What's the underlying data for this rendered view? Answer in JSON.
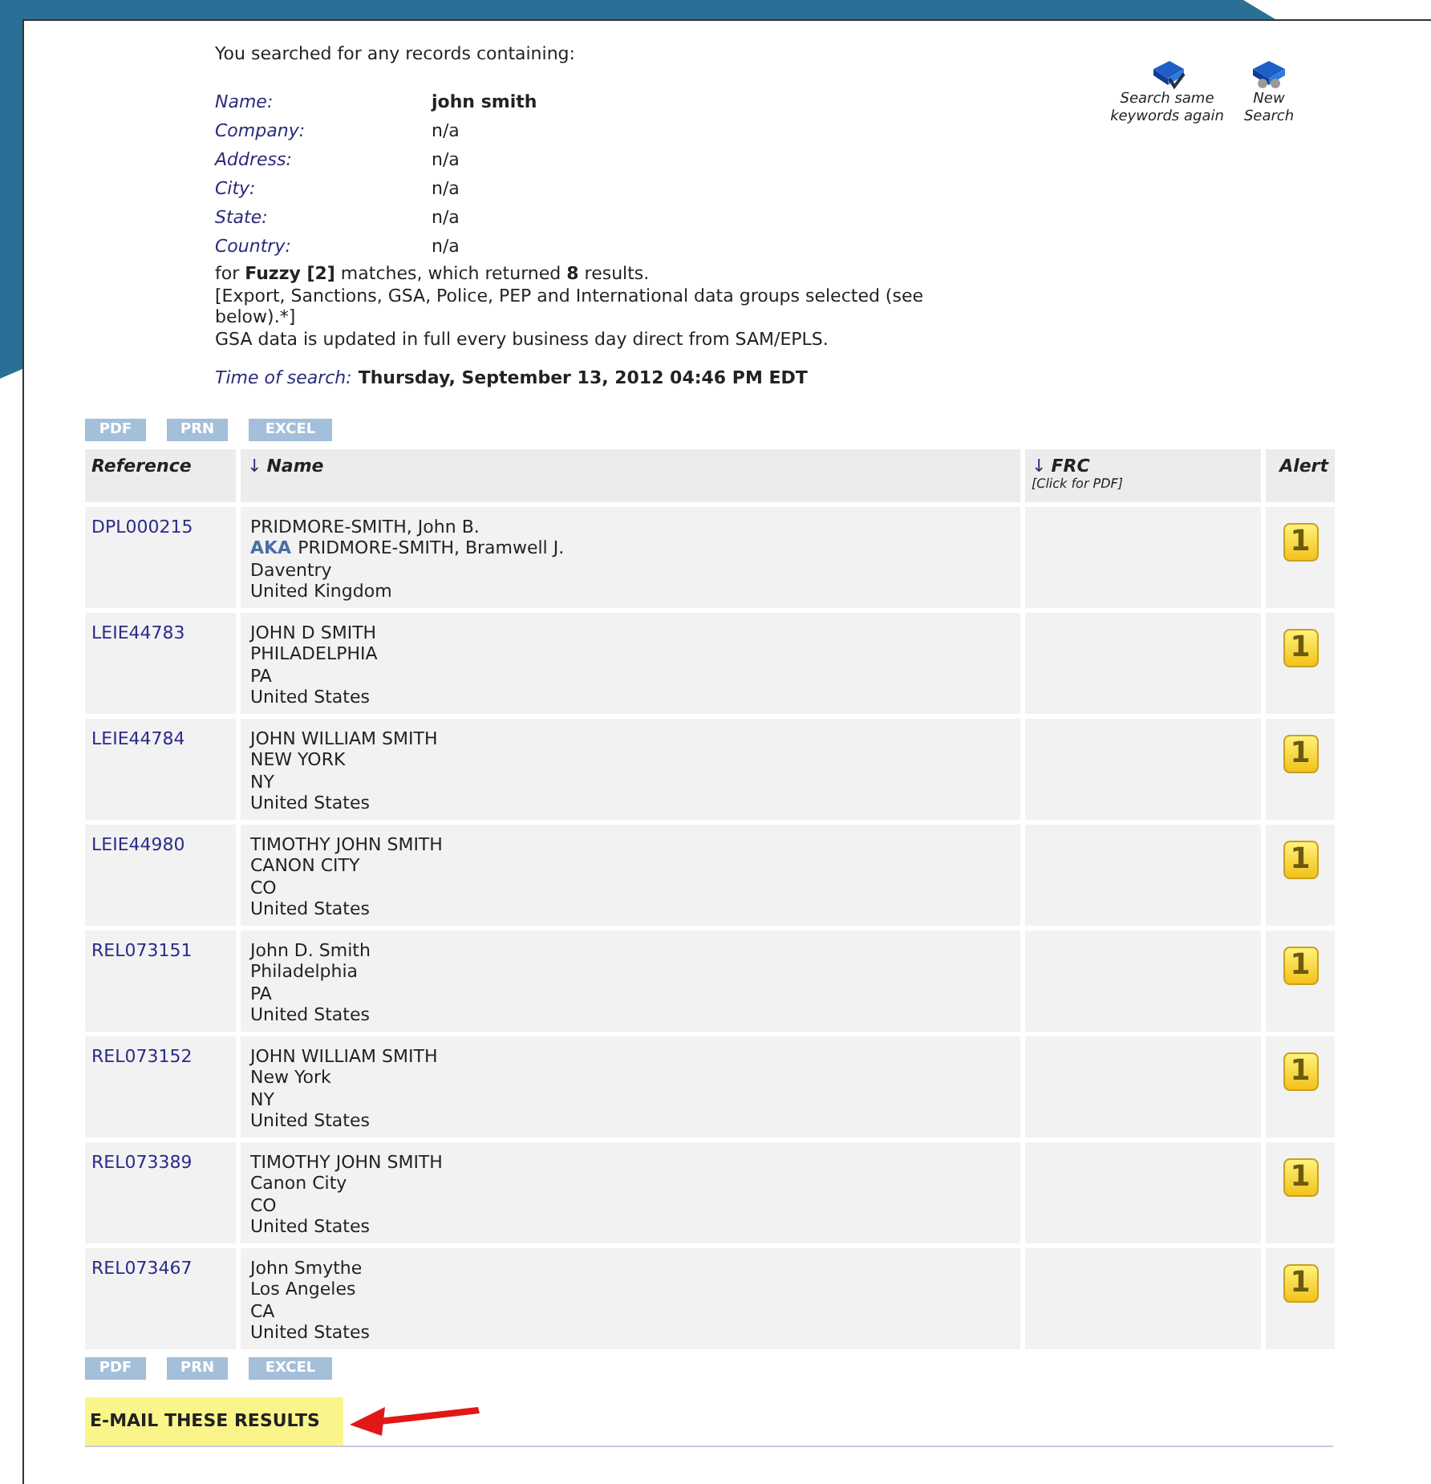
{
  "intro": "You searched for any records containing:",
  "criteria": [
    {
      "label": "Name:",
      "value": "john smith",
      "bold": true
    },
    {
      "label": "Company:",
      "value": "n/a",
      "bold": false
    },
    {
      "label": "Address:",
      "value": "n/a",
      "bold": false
    },
    {
      "label": "City:",
      "value": "n/a",
      "bold": false
    },
    {
      "label": "State:",
      "value": "n/a",
      "bold": false
    },
    {
      "label": "Country:",
      "value": "n/a",
      "bold": false
    }
  ],
  "summary": [
    "for **Fuzzy [2]** matches, which returned **8** results.",
    "[Export, Sanctions, GSA, Police, PEP and International data groups selected (see below).*]",
    "GSA data is updated in full every business day direct from SAM/EPLS."
  ],
  "time_label": "Time of search:",
  "time_value": "Thursday, September 13, 2012 04:46 PM EDT",
  "actions": [
    {
      "kind": "again",
      "label": "Search same keywords again"
    },
    {
      "kind": "new",
      "label": "New Search"
    }
  ],
  "export_buttons_top": [
    "PDF",
    "PRN",
    "EXCEL"
  ],
  "export_buttons_bottom": [
    "PDF",
    "PRN",
    "EXCEL"
  ],
  "columns": [
    {
      "label": "Reference"
    },
    {
      "label": "Name",
      "sort_arrow": "↓"
    },
    {
      "label": "FRC",
      "sort_arrow": "↓",
      "note": "[Click for PDF]"
    },
    {
      "label": "Alert"
    }
  ],
  "rows": [
    {
      "reference": "DPL000215",
      "name": "PRIDMORE-SMITH, John B.",
      "aka_label": "AKA",
      "aka": "PRIDMORE-SMITH, Bramwell J.",
      "city": "Daventry",
      "country": "United Kingdom",
      "alert": "1"
    },
    {
      "reference": "LEIE44783",
      "name": "JOHN D SMITH",
      "city": "PHILADELPHIA",
      "state": "PA",
      "country": "United States",
      "alert": "1"
    },
    {
      "reference": "LEIE44784",
      "name": "JOHN WILLIAM SMITH",
      "city": "NEW YORK",
      "state": "NY",
      "country": "United States",
      "alert": "1"
    },
    {
      "reference": "LEIE44980",
      "name": "TIMOTHY JOHN SMITH",
      "city": "CANON CITY",
      "state": "CO",
      "country": "United States",
      "alert": "1"
    },
    {
      "reference": "REL073151",
      "name": "John D. Smith",
      "city": "Philadelphia",
      "state": "PA",
      "country": "United States",
      "alert": "1"
    },
    {
      "reference": "REL073152",
      "name": "JOHN WILLIAM SMITH",
      "city": "New York",
      "state": "NY",
      "country": "United States",
      "alert": "1"
    },
    {
      "reference": "REL073389",
      "name": "TIMOTHY JOHN SMITH",
      "city": "Canon City",
      "state": "CO",
      "country": "United States",
      "alert": "1"
    },
    {
      "reference": "REL073467",
      "name": "John Smythe",
      "city": "Los Angeles",
      "state": "CA",
      "country": "United States",
      "alert": "1"
    }
  ],
  "email_link": "E-MAIL THESE RESULTS"
}
